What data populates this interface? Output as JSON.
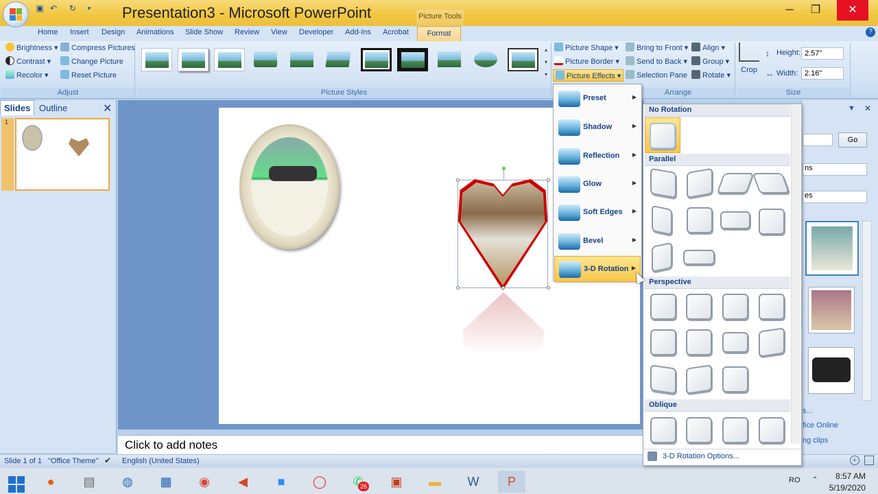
{
  "window": {
    "title": "Presentation3 - Microsoft PowerPoint",
    "context_tab": "Picture Tools",
    "minimize": "─",
    "maximize": "❐",
    "close": "✕"
  },
  "tabs": [
    "Home",
    "Insert",
    "Design",
    "Animations",
    "Slide Show",
    "Review",
    "View",
    "Developer",
    "Add-Ins",
    "Acrobat",
    "Format"
  ],
  "ribbon": {
    "adjust": {
      "label": "Adjust",
      "brightness": "Brightness",
      "contrast": "Contrast",
      "recolor": "Recolor",
      "compress": "Compress Pictures",
      "change": "Change Picture",
      "reset": "Reset Picture"
    },
    "styles": {
      "label": "Picture Styles"
    },
    "picture": {
      "shape": "Picture Shape",
      "border": "Picture Border",
      "effects": "Picture Effects"
    },
    "arrange": {
      "label": "Arrange",
      "front": "Bring to Front",
      "back": "Send to Back",
      "pane": "Selection Pane",
      "align": "Align",
      "group": "Group",
      "rotate": "Rotate"
    },
    "size": {
      "label": "Size",
      "crop": "Crop",
      "height_label": "Height:",
      "height": "2.57\"",
      "width_label": "Width:",
      "width": "2.16\""
    }
  },
  "left_pane": {
    "slides_tab": "Slides",
    "outline_tab": "Outline",
    "close": "✕",
    "slide_number": "1"
  },
  "effects_menu": {
    "items": [
      "Preset",
      "Shadow",
      "Reflection",
      "Glow",
      "Soft Edges",
      "Bevel",
      "3-D Rotation"
    ],
    "active": "3-D Rotation"
  },
  "rotation_gallery": {
    "sections": [
      "No Rotation",
      "Parallel",
      "Perspective",
      "Oblique"
    ],
    "options_link": "3-D Rotation Options..."
  },
  "right_pane": {
    "go_button": "Go",
    "field1": "ns",
    "field2": "es",
    "link1": "s...",
    "link2": "fice Online",
    "link3": "ng clips"
  },
  "notes": {
    "placeholder": "Click to add notes"
  },
  "status": {
    "slide": "Slide 1 of 1",
    "theme": "\"Office Theme\"",
    "language": "English (United States)"
  },
  "taskbar": {
    "lang": "RO",
    "time": "8:57 AM",
    "date": "5/19/2020",
    "badge": "26"
  }
}
